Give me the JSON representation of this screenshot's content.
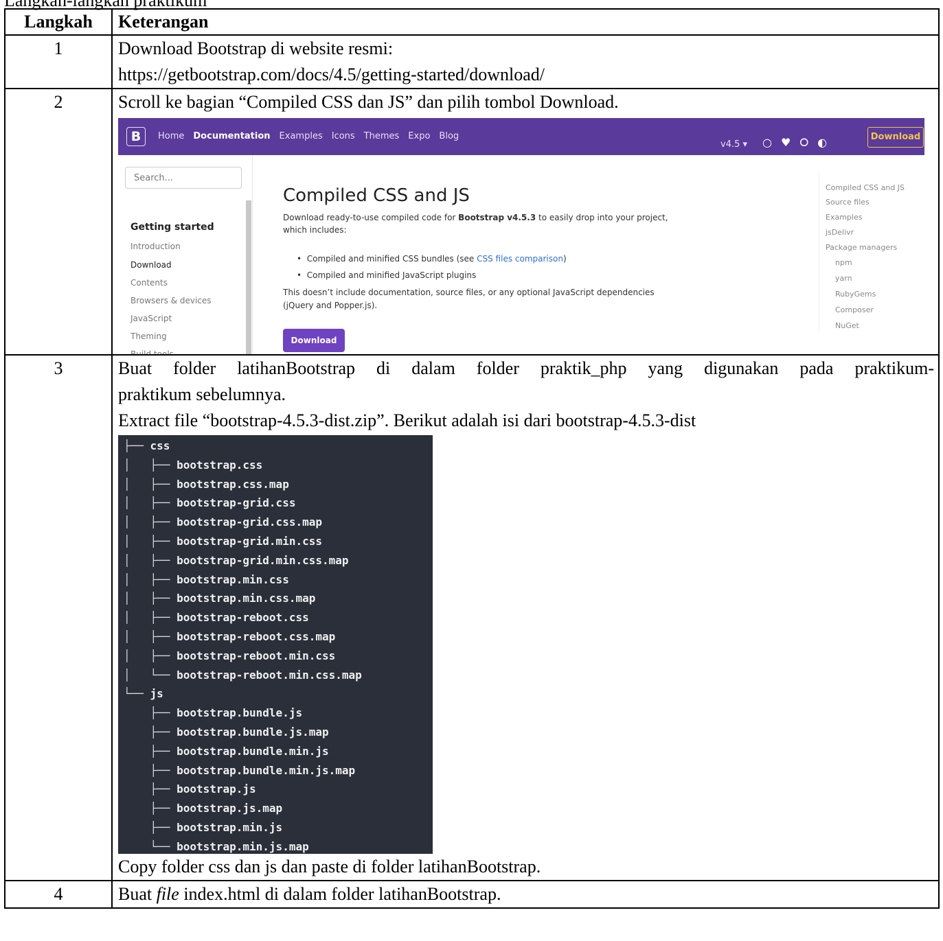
{
  "top_fragment": "Langkah-langkah praktikum",
  "table": {
    "headers": [
      "Langkah",
      "Keterangan"
    ],
    "rows": [
      {
        "num": "1",
        "lines": [
          "Download Bootstrap di website resmi:",
          "https://getbootstrap.com/docs/4.5/getting-started/download/"
        ]
      },
      {
        "num": "2",
        "lines": [
          "Scroll ke bagian “Compiled CSS dan JS” dan pilih tombol Download."
        ]
      },
      {
        "num": "3",
        "lines": [
          "Buat folder latihanBootstrap di dalam folder praktik_php yang digunakan pada praktikum-",
          "praktikum sebelumnya.",
          "Extract file “bootstrap-4.5.3-dist.zip”. Berikut adalah isi dari bootstrap-4.5.3-dist"
        ],
        "after": "Copy folder css dan js dan paste di folder latihanBootstrap."
      },
      {
        "num": "4",
        "pre": "Buat ",
        "italic": "file",
        "post": " index.html di dalam folder latihanBootstrap."
      }
    ]
  },
  "bootstrap_shot": {
    "logo": "B",
    "nav": [
      "Home",
      "Documentation",
      "Examples",
      "Icons",
      "Themes",
      "Expo",
      "Blog"
    ],
    "version": "v4.5 ▾",
    "download_btn": "Download",
    "search_placeholder": "Search...",
    "sidebar_heading": "Getting started",
    "sidebar_items": [
      "Introduction",
      "Download",
      "Contents",
      "Browsers & devices",
      "JavaScript",
      "Theming",
      "Build tools"
    ],
    "heading": "Compiled CSS and JS",
    "para1a": "Download ready-to-use compiled code for ",
    "para1b": "Bootstrap v4.5.3",
    "para1c": " to easily drop into your project,",
    "para1d": "which includes:",
    "li1a": "Compiled and minified CSS bundles (see ",
    "li1link": "CSS files comparison",
    "li1c": ")",
    "li2": "Compiled and minified JavaScript plugins",
    "para2a": "This doesn’t include documentation, source files, or any optional JavaScript dependencies",
    "para2b": "(jQuery and Popper.js).",
    "main_btn": "Download",
    "toc": [
      "Compiled CSS and JS",
      "Source files",
      "Examples",
      "jsDelivr",
      "Package managers"
    ],
    "toc_sub": [
      "npm",
      "yarn",
      "RubyGems",
      "Composer",
      "NuGet"
    ]
  },
  "tree": [
    {
      "prefix": "├── ",
      "name": "css"
    },
    {
      "prefix": "│   ├── ",
      "name": "bootstrap.css"
    },
    {
      "prefix": "│   ├── ",
      "name": "bootstrap.css.map"
    },
    {
      "prefix": "│   ├── ",
      "name": "bootstrap-grid.css"
    },
    {
      "prefix": "│   ├── ",
      "name": "bootstrap-grid.css.map"
    },
    {
      "prefix": "│   ├── ",
      "name": "bootstrap-grid.min.css"
    },
    {
      "prefix": "│   ├── ",
      "name": "bootstrap-grid.min.css.map"
    },
    {
      "prefix": "│   ├── ",
      "name": "bootstrap.min.css"
    },
    {
      "prefix": "│   ├── ",
      "name": "bootstrap.min.css.map"
    },
    {
      "prefix": "│   ├── ",
      "name": "bootstrap-reboot.css"
    },
    {
      "prefix": "│   ├── ",
      "name": "bootstrap-reboot.css.map"
    },
    {
      "prefix": "│   ├── ",
      "name": "bootstrap-reboot.min.css"
    },
    {
      "prefix": "│   └── ",
      "name": "bootstrap-reboot.min.css.map"
    },
    {
      "prefix": "└── ",
      "name": "js"
    },
    {
      "prefix": "    ├── ",
      "name": "bootstrap.bundle.js"
    },
    {
      "prefix": "    ├── ",
      "name": "bootstrap.bundle.js.map"
    },
    {
      "prefix": "    ├── ",
      "name": "bootstrap.bundle.min.js"
    },
    {
      "prefix": "    ├── ",
      "name": "bootstrap.bundle.min.js.map"
    },
    {
      "prefix": "    ├── ",
      "name": "bootstrap.js"
    },
    {
      "prefix": "    ├── ",
      "name": "bootstrap.js.map"
    },
    {
      "prefix": "    ├── ",
      "name": "bootstrap.min.js"
    },
    {
      "prefix": "    └── ",
      "name": "bootstrap.min.js.map"
    }
  ]
}
